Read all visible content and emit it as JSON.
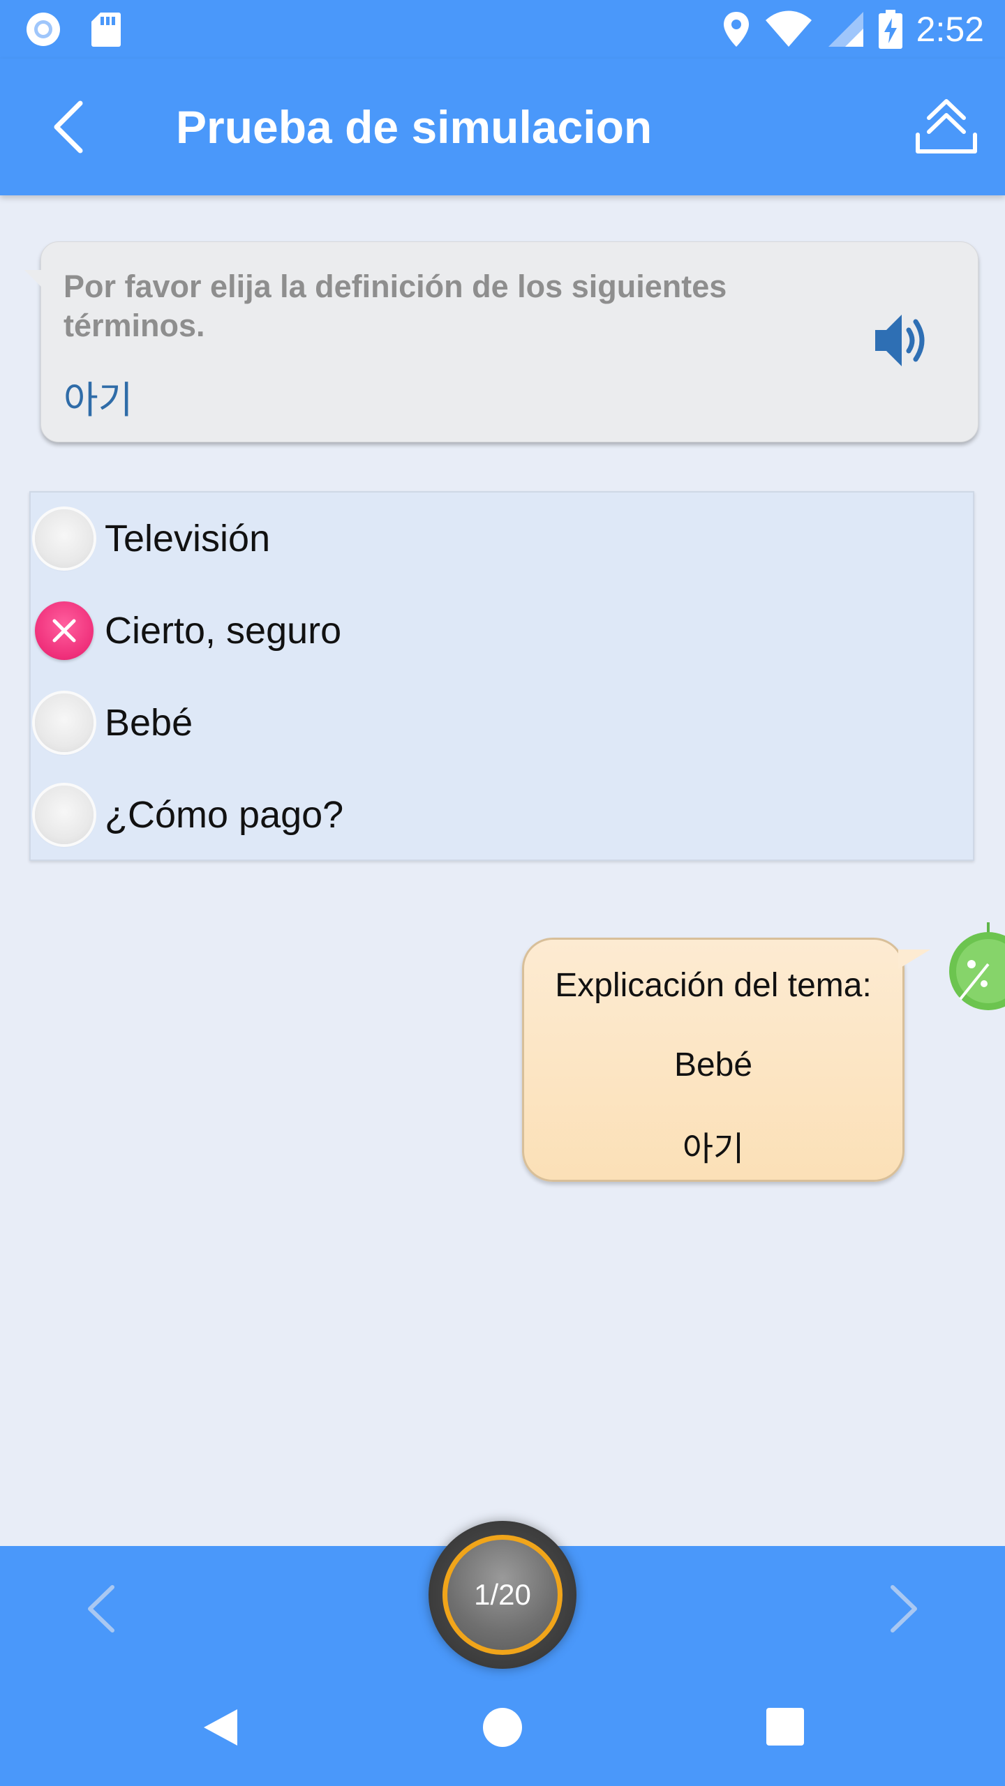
{
  "status_bar": {
    "time": "2:52",
    "icons": [
      "circle-notification-icon",
      "sd-card-icon",
      "location-icon",
      "wifi-icon",
      "signal-icon",
      "battery-charging-icon"
    ]
  },
  "app_bar": {
    "title": "Prueba de simulacion",
    "back_icon": "chevron-left-icon",
    "share_icon": "upload-icon"
  },
  "question": {
    "prompt": "Por favor elija la definición de los siguientes términos.",
    "term": "아기",
    "speaker_icon": "speaker-icon"
  },
  "options": [
    {
      "label": "Televisión",
      "state": "unselected"
    },
    {
      "label": "Cierto, seguro",
      "state": "wrong"
    },
    {
      "label": "Bebé",
      "state": "unselected"
    },
    {
      "label": "¿Cómo pago?",
      "state": "unselected"
    }
  ],
  "explanation": {
    "title": "Explicación del tema:",
    "answer": "Bebé",
    "term": "아기"
  },
  "progress": {
    "counter": "1/20",
    "current": 1,
    "total": 20
  },
  "colors": {
    "primary": "#4a98fa",
    "wrong": "#ef2f7a",
    "ring": "#f1a51a",
    "term": "#2f6ca8"
  }
}
